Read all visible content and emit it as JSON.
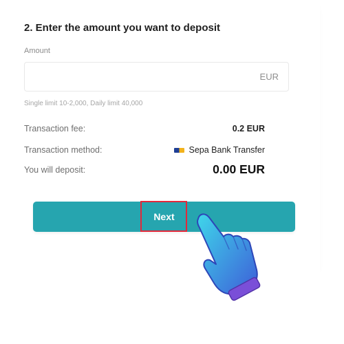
{
  "deposit_form": {
    "title": "2. Enter the amount you want to deposit",
    "amount_label": "Amount",
    "amount_value": "",
    "currency": "EUR",
    "limits_hint": "Single limit 10-2,000, Daily limit 40,000",
    "fee_label": "Transaction fee:",
    "fee_value": "0.2 EUR",
    "method_label": "Transaction method:",
    "method_value": "Sepa Bank Transfer",
    "method_icon": "sepa-logo",
    "deposit_label": "You will deposit:",
    "deposit_value": "0.00 EUR",
    "next_label": "Next"
  },
  "colors": {
    "accent": "#26a5af",
    "highlight": "#e3283a",
    "hand_gradient_start": "#3fd6ea",
    "hand_gradient_end": "#3d5ed8",
    "cuff": "#7a4fd8"
  }
}
